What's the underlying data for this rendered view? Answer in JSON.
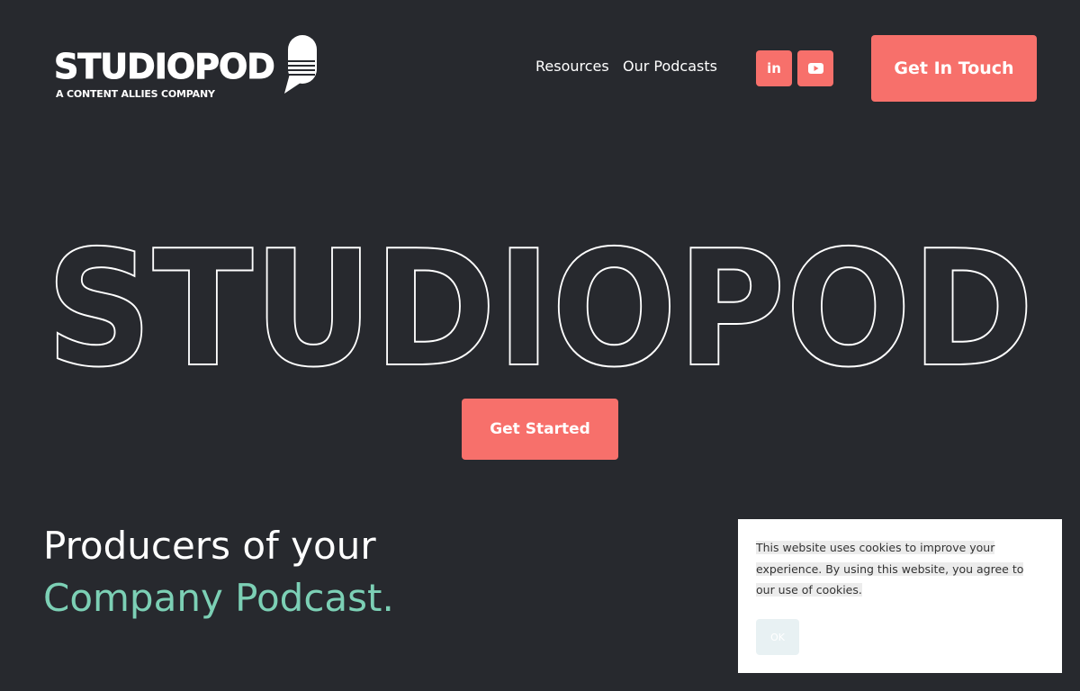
{
  "header": {
    "logo_text": "STUDIOPOD",
    "logo_tagline": "A CONTENT ALLIES COMPANY",
    "nav": [
      {
        "label": "Resources"
      },
      {
        "label": "Our Podcasts"
      }
    ],
    "social": {
      "linkedin_label": "in",
      "youtube_icon": "youtube-play-icon"
    },
    "cta_label": "Get In Touch"
  },
  "hero": {
    "outline_word": "STUDIOPOD",
    "cta_label": "Get Started",
    "headline_line1": "Producers of your",
    "headline_line2": "Company Podcast."
  },
  "cookie": {
    "message": "This website uses cookies to improve your experience. By using this website, you agree to our use of cookies.",
    "ok_label": "OK"
  },
  "colors": {
    "background": "#27292e",
    "accent": "#f7706b",
    "highlight": "#7cd0b5",
    "text": "#ffffff"
  }
}
